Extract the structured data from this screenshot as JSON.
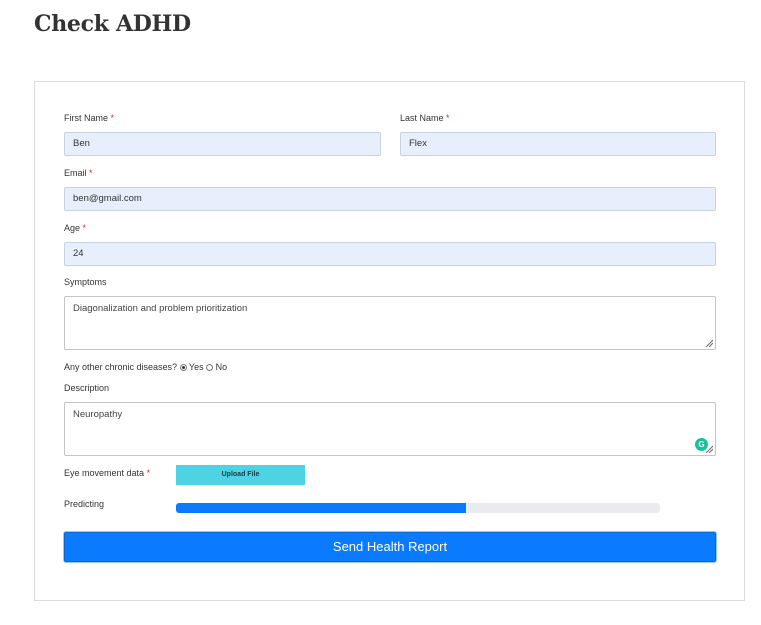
{
  "page": {
    "title": "Check ADHD"
  },
  "form": {
    "first_name": {
      "label": "First Name",
      "required_mark": "*",
      "value": "Ben"
    },
    "last_name": {
      "label": "Last Name",
      "required_mark": "*",
      "value": "Flex"
    },
    "email": {
      "label": "Email",
      "required_mark": "*",
      "value": "ben@gmail.com"
    },
    "age": {
      "label": "Age",
      "required_mark": "*",
      "value": "24"
    },
    "symptoms": {
      "label": "Symptoms",
      "value": "Diagonalization and problem prioritization"
    },
    "chronic": {
      "label": "Any other chronic diseases?",
      "options": [
        "Yes",
        "No"
      ],
      "selected": "Yes"
    },
    "description": {
      "label": "Description",
      "value": "Neuropathy"
    },
    "eye_movement": {
      "label": "Eye movement data",
      "required_mark": "*",
      "button_label": "Upload File"
    },
    "predicting": {
      "label": "Predicting",
      "progress_percent": 60
    },
    "submit_label": "Send Health Report"
  },
  "colors": {
    "primary": "#0a7bff",
    "upload_button": "#4dd3e3",
    "input_fill": "#e8effc",
    "required": "#e02424",
    "grammarly": "#15c39a"
  },
  "icons": {
    "textarea_widget": "grammarly-icon",
    "resize": "resize-handle-icon"
  }
}
